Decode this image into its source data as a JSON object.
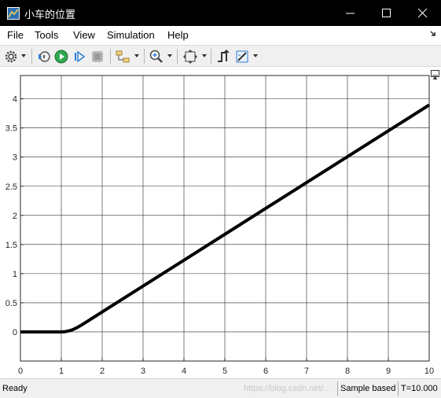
{
  "window": {
    "title": "小车的位置",
    "icon": "matlab-scope-icon"
  },
  "menubar": {
    "items": [
      "File",
      "Tools",
      "View",
      "Simulation",
      "Help"
    ]
  },
  "toolbar": {
    "buttons": [
      {
        "name": "settings-icon"
      },
      {
        "name": "step-back-icon"
      },
      {
        "name": "run-icon"
      },
      {
        "name": "step-forward-icon"
      },
      {
        "name": "stop-icon"
      },
      {
        "name": "highlight-simulink-block-icon"
      },
      {
        "name": "zoom-in-icon"
      },
      {
        "name": "autoscale-icon"
      },
      {
        "name": "triggers-icon"
      },
      {
        "name": "measurements-icon"
      }
    ]
  },
  "status": {
    "left": "Ready",
    "mode": "Sample based",
    "time": "T=10.000",
    "watermark": "https://blog.csdn.net/..."
  },
  "chart_data": {
    "type": "line",
    "xlim": [
      0,
      10
    ],
    "ylim": [
      -0.5,
      4.4
    ],
    "xticks": [
      "0",
      "1",
      "2",
      "3",
      "4",
      "5",
      "6",
      "7",
      "8",
      "9",
      "10"
    ],
    "yticks": [
      "0",
      "0.5",
      "1",
      "1.5",
      "2",
      "2.5",
      "3",
      "3.5",
      "4"
    ],
    "grid": true,
    "colors": {
      "line": "#000000",
      "grid": "#262626",
      "background": "#ffffff"
    },
    "series": [
      {
        "x": [
          0,
          1.0,
          1.1,
          1.2,
          1.3,
          1.4,
          1.5,
          2,
          3,
          4,
          5,
          6,
          7,
          8,
          9,
          10
        ],
        "y": [
          0,
          0,
          0.005,
          0.02,
          0.045,
          0.08,
          0.12,
          0.343,
          0.787,
          1.231,
          1.675,
          2.119,
          2.563,
          3.007,
          3.451,
          3.895
        ]
      }
    ]
  }
}
